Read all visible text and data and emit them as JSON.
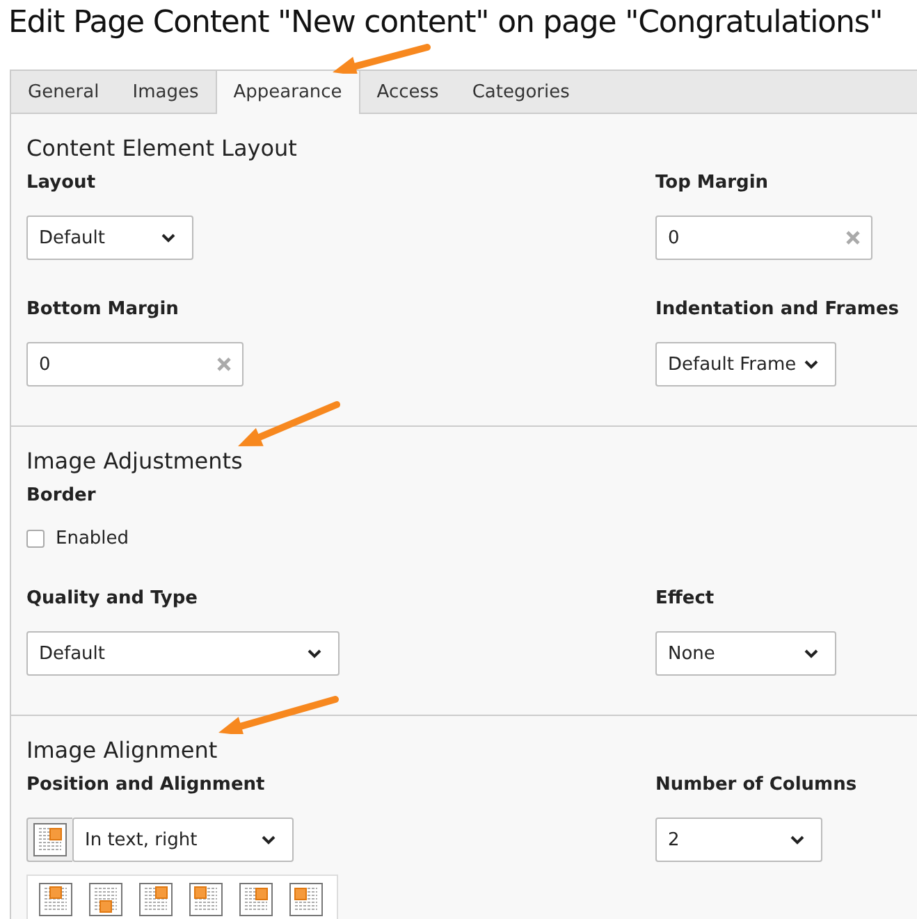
{
  "title": "Edit Page Content \"New content\" on page \"Congratulations\"",
  "tabs": [
    {
      "label": "General",
      "selected": false
    },
    {
      "label": "Images",
      "selected": false
    },
    {
      "label": "Appearance",
      "selected": true
    },
    {
      "label": "Access",
      "selected": false
    },
    {
      "label": "Categories",
      "selected": false
    }
  ],
  "sections": [
    {
      "title": "Content Element Layout",
      "fields": [
        {
          "label": "Layout",
          "kind": "select",
          "value": "Default"
        },
        {
          "label": "Top Margin",
          "kind": "input",
          "value": "0"
        },
        {
          "label": "Bottom Margin",
          "kind": "input",
          "value": "0"
        },
        {
          "label": "Indentation and Frames",
          "kind": "select",
          "value": "Default Frame"
        }
      ]
    },
    {
      "title": "Image Adjustments",
      "fields": [
        {
          "label": "Border",
          "kind": "checkbox",
          "option": "Enabled",
          "checked": false
        },
        {
          "label": "Quality and Type",
          "kind": "select",
          "value": "Default"
        },
        {
          "label": "Effect",
          "kind": "select",
          "value": "None"
        }
      ]
    },
    {
      "title": "Image Alignment",
      "fields": [
        {
          "label": "Position and Alignment",
          "kind": "iconselect",
          "value": "In text, right"
        },
        {
          "label": "Number of Columns",
          "kind": "select",
          "value": "2"
        }
      ]
    }
  ]
}
